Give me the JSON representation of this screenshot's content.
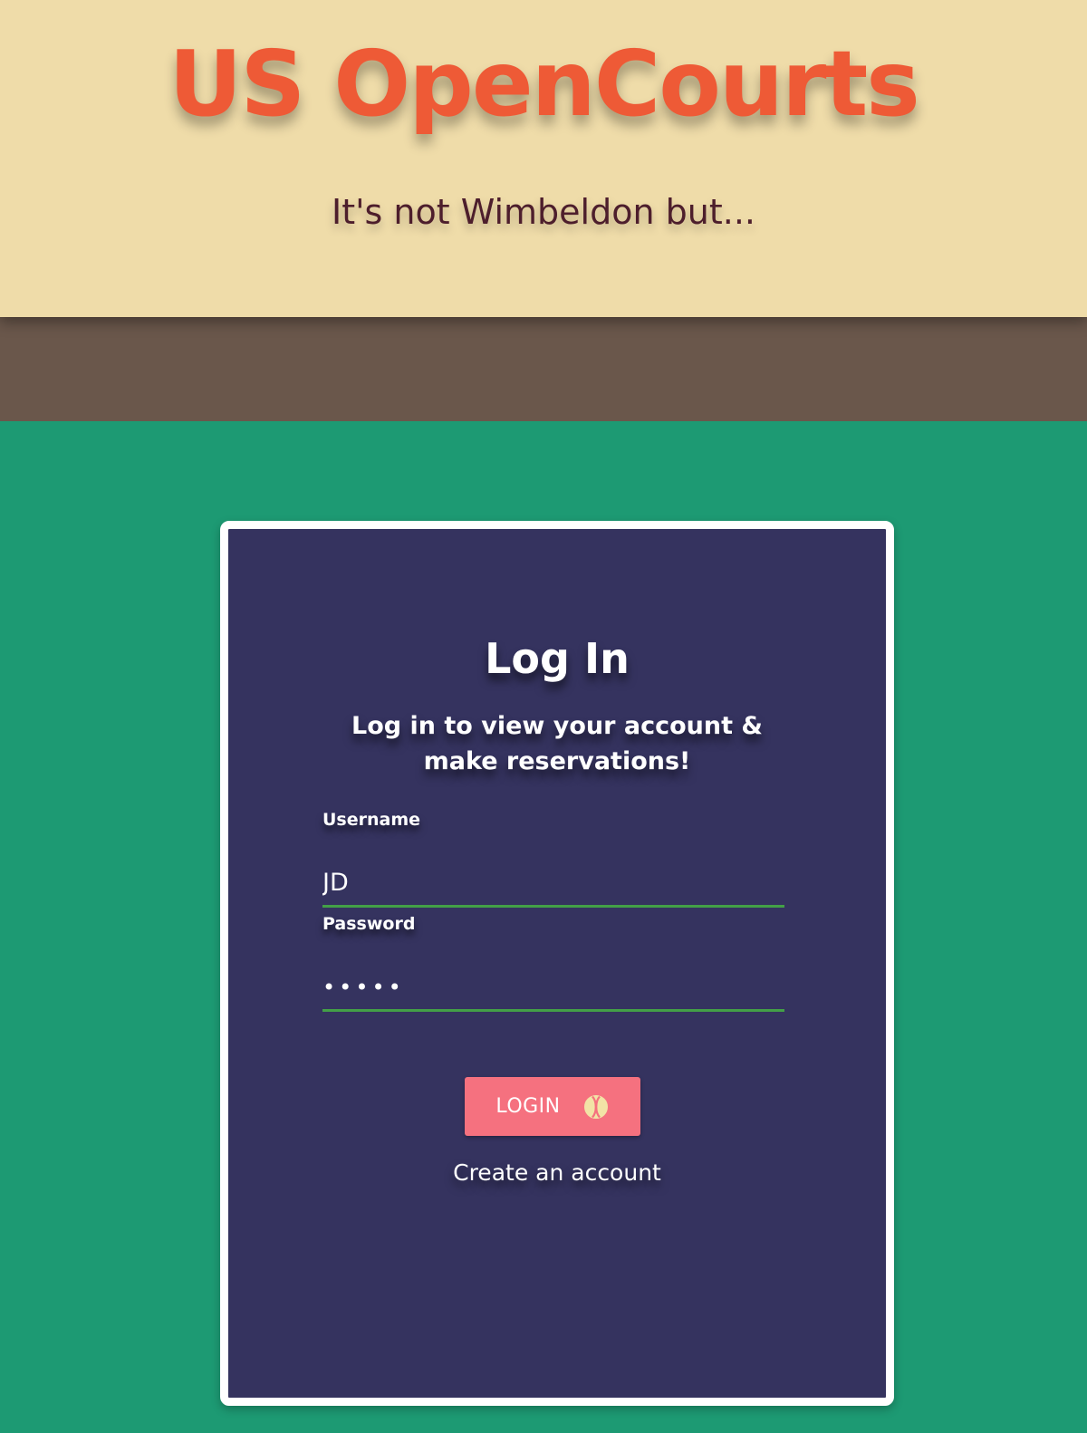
{
  "header": {
    "title": "US OpenCourts",
    "subtitle": "It's not Wimbeldon but..."
  },
  "login_card": {
    "title": "Log In",
    "subtitle": "Log in to view your account & make reservations!",
    "username": {
      "label": "Username",
      "value": "JD"
    },
    "password": {
      "label": "Password",
      "value": "•••••"
    },
    "login_button": {
      "label": "LOGIN",
      "icon": "tennis-ball-icon"
    },
    "create_account_link": "Create an account"
  },
  "colors": {
    "hero_background": "#efdca9",
    "title_color": "#ee5a36",
    "subtitle_color": "#4d1e2c",
    "band_color": "#6a574b",
    "page_background": "#1d9a73",
    "card_background": "#35335f",
    "input_underline": "#43a047",
    "button_color": "#f5717f"
  }
}
